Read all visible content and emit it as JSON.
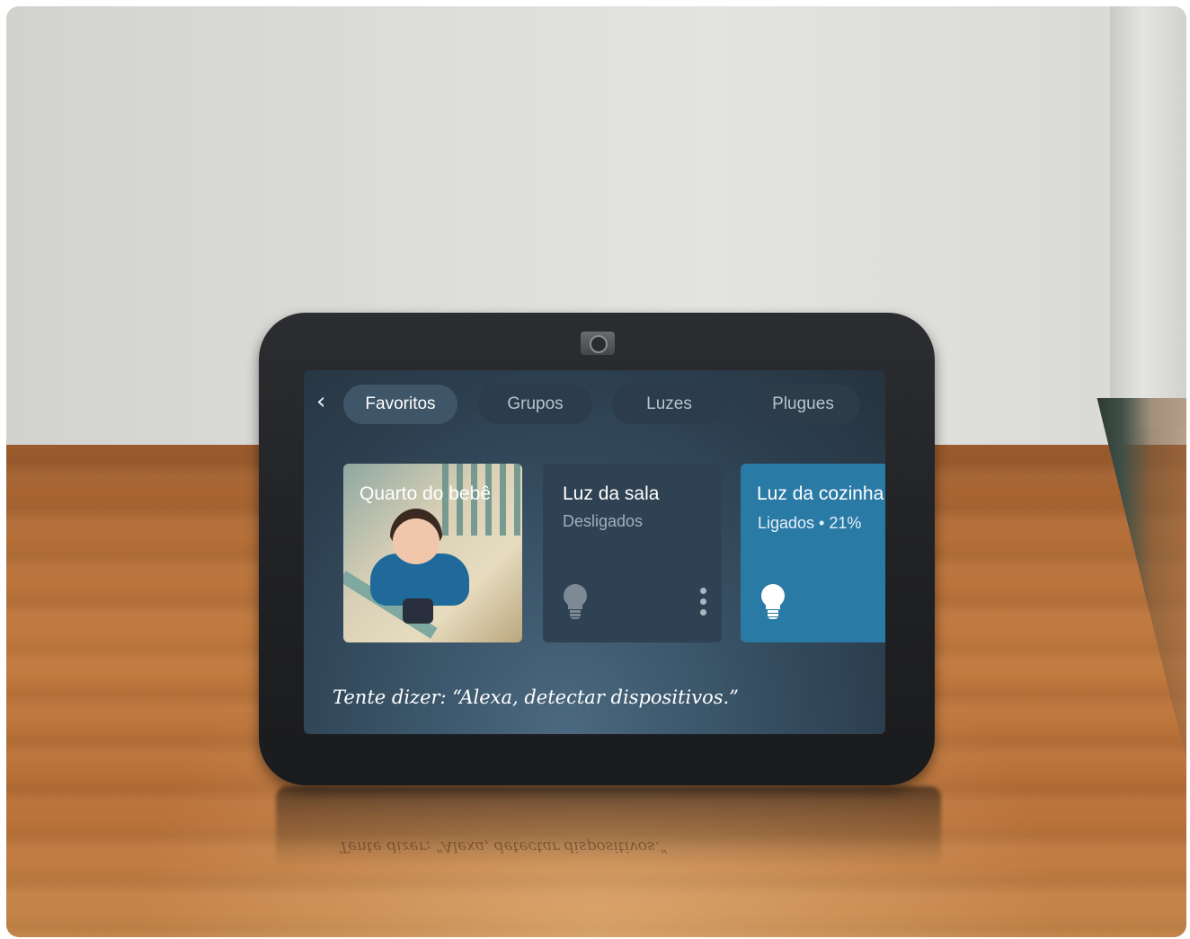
{
  "device": {
    "tabs": [
      {
        "label": "Favoritos",
        "active": true
      },
      {
        "label": "Grupos",
        "active": false
      },
      {
        "label": "Luzes",
        "active": false
      },
      {
        "label": "Plugues",
        "active": false
      }
    ],
    "cards": [
      {
        "type": "camera",
        "title": "Quarto do bebê"
      },
      {
        "type": "light",
        "title": "Luz da sala",
        "status": "Desligados",
        "state": "off",
        "icon": "lightbulb-icon"
      },
      {
        "type": "light",
        "title": "Luz da cozinha",
        "status": "Ligados • 21%",
        "state": "on",
        "icon": "lightbulb-icon"
      }
    ],
    "hint": "Tente dizer: “Alexa, detectar dispositivos.”",
    "reflection_hint": "Tente dizer: “Alexa, detectar dispositivos.”"
  },
  "colors": {
    "screen_bg": "#2c3f4f",
    "active_chip": "#3f5668",
    "card_bg": "#2f4253",
    "accent_card": "#2a7aa6"
  }
}
